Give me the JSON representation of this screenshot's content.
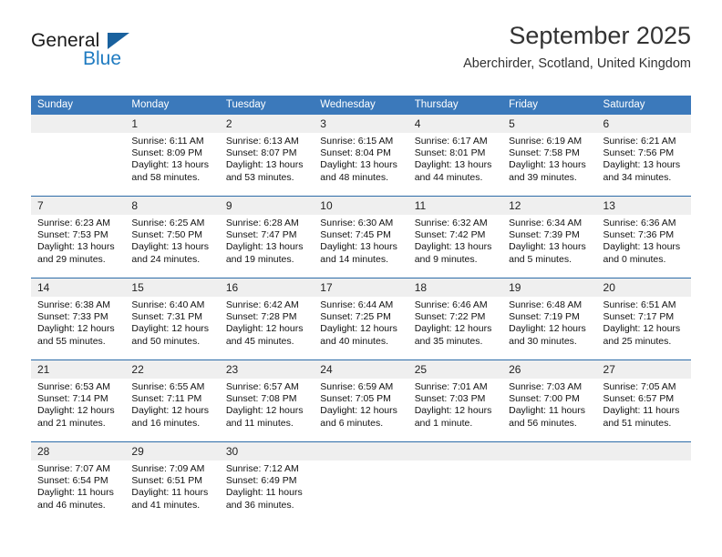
{
  "brand": {
    "name_top": "General",
    "name_bottom": "Blue",
    "accent_color": "#1f7bc1",
    "triangle_color": "#19619e"
  },
  "header": {
    "title": "September 2025",
    "subtitle": "Aberchirder, Scotland, United Kingdom"
  },
  "calendar": {
    "header_bg": "#3b79bb",
    "daynum_bg": "#efefef",
    "row_divider": "#2d6ca8",
    "weekdays": [
      "Sunday",
      "Monday",
      "Tuesday",
      "Wednesday",
      "Thursday",
      "Friday",
      "Saturday"
    ],
    "weeks": [
      [
        {
          "day": "",
          "sunrise": "",
          "sunset": "",
          "daylight": ""
        },
        {
          "day": "1",
          "sunrise": "Sunrise: 6:11 AM",
          "sunset": "Sunset: 8:09 PM",
          "daylight": "Daylight: 13 hours and 58 minutes."
        },
        {
          "day": "2",
          "sunrise": "Sunrise: 6:13 AM",
          "sunset": "Sunset: 8:07 PM",
          "daylight": "Daylight: 13 hours and 53 minutes."
        },
        {
          "day": "3",
          "sunrise": "Sunrise: 6:15 AM",
          "sunset": "Sunset: 8:04 PM",
          "daylight": "Daylight: 13 hours and 48 minutes."
        },
        {
          "day": "4",
          "sunrise": "Sunrise: 6:17 AM",
          "sunset": "Sunset: 8:01 PM",
          "daylight": "Daylight: 13 hours and 44 minutes."
        },
        {
          "day": "5",
          "sunrise": "Sunrise: 6:19 AM",
          "sunset": "Sunset: 7:58 PM",
          "daylight": "Daylight: 13 hours and 39 minutes."
        },
        {
          "day": "6",
          "sunrise": "Sunrise: 6:21 AM",
          "sunset": "Sunset: 7:56 PM",
          "daylight": "Daylight: 13 hours and 34 minutes."
        }
      ],
      [
        {
          "day": "7",
          "sunrise": "Sunrise: 6:23 AM",
          "sunset": "Sunset: 7:53 PM",
          "daylight": "Daylight: 13 hours and 29 minutes."
        },
        {
          "day": "8",
          "sunrise": "Sunrise: 6:25 AM",
          "sunset": "Sunset: 7:50 PM",
          "daylight": "Daylight: 13 hours and 24 minutes."
        },
        {
          "day": "9",
          "sunrise": "Sunrise: 6:28 AM",
          "sunset": "Sunset: 7:47 PM",
          "daylight": "Daylight: 13 hours and 19 minutes."
        },
        {
          "day": "10",
          "sunrise": "Sunrise: 6:30 AM",
          "sunset": "Sunset: 7:45 PM",
          "daylight": "Daylight: 13 hours and 14 minutes."
        },
        {
          "day": "11",
          "sunrise": "Sunrise: 6:32 AM",
          "sunset": "Sunset: 7:42 PM",
          "daylight": "Daylight: 13 hours and 9 minutes."
        },
        {
          "day": "12",
          "sunrise": "Sunrise: 6:34 AM",
          "sunset": "Sunset: 7:39 PM",
          "daylight": "Daylight: 13 hours and 5 minutes."
        },
        {
          "day": "13",
          "sunrise": "Sunrise: 6:36 AM",
          "sunset": "Sunset: 7:36 PM",
          "daylight": "Daylight: 13 hours and 0 minutes."
        }
      ],
      [
        {
          "day": "14",
          "sunrise": "Sunrise: 6:38 AM",
          "sunset": "Sunset: 7:33 PM",
          "daylight": "Daylight: 12 hours and 55 minutes."
        },
        {
          "day": "15",
          "sunrise": "Sunrise: 6:40 AM",
          "sunset": "Sunset: 7:31 PM",
          "daylight": "Daylight: 12 hours and 50 minutes."
        },
        {
          "day": "16",
          "sunrise": "Sunrise: 6:42 AM",
          "sunset": "Sunset: 7:28 PM",
          "daylight": "Daylight: 12 hours and 45 minutes."
        },
        {
          "day": "17",
          "sunrise": "Sunrise: 6:44 AM",
          "sunset": "Sunset: 7:25 PM",
          "daylight": "Daylight: 12 hours and 40 minutes."
        },
        {
          "day": "18",
          "sunrise": "Sunrise: 6:46 AM",
          "sunset": "Sunset: 7:22 PM",
          "daylight": "Daylight: 12 hours and 35 minutes."
        },
        {
          "day": "19",
          "sunrise": "Sunrise: 6:48 AM",
          "sunset": "Sunset: 7:19 PM",
          "daylight": "Daylight: 12 hours and 30 minutes."
        },
        {
          "day": "20",
          "sunrise": "Sunrise: 6:51 AM",
          "sunset": "Sunset: 7:17 PM",
          "daylight": "Daylight: 12 hours and 25 minutes."
        }
      ],
      [
        {
          "day": "21",
          "sunrise": "Sunrise: 6:53 AM",
          "sunset": "Sunset: 7:14 PM",
          "daylight": "Daylight: 12 hours and 21 minutes."
        },
        {
          "day": "22",
          "sunrise": "Sunrise: 6:55 AM",
          "sunset": "Sunset: 7:11 PM",
          "daylight": "Daylight: 12 hours and 16 minutes."
        },
        {
          "day": "23",
          "sunrise": "Sunrise: 6:57 AM",
          "sunset": "Sunset: 7:08 PM",
          "daylight": "Daylight: 12 hours and 11 minutes."
        },
        {
          "day": "24",
          "sunrise": "Sunrise: 6:59 AM",
          "sunset": "Sunset: 7:05 PM",
          "daylight": "Daylight: 12 hours and 6 minutes."
        },
        {
          "day": "25",
          "sunrise": "Sunrise: 7:01 AM",
          "sunset": "Sunset: 7:03 PM",
          "daylight": "Daylight: 12 hours and 1 minute."
        },
        {
          "day": "26",
          "sunrise": "Sunrise: 7:03 AM",
          "sunset": "Sunset: 7:00 PM",
          "daylight": "Daylight: 11 hours and 56 minutes."
        },
        {
          "day": "27",
          "sunrise": "Sunrise: 7:05 AM",
          "sunset": "Sunset: 6:57 PM",
          "daylight": "Daylight: 11 hours and 51 minutes."
        }
      ],
      [
        {
          "day": "28",
          "sunrise": "Sunrise: 7:07 AM",
          "sunset": "Sunset: 6:54 PM",
          "daylight": "Daylight: 11 hours and 46 minutes."
        },
        {
          "day": "29",
          "sunrise": "Sunrise: 7:09 AM",
          "sunset": "Sunset: 6:51 PM",
          "daylight": "Daylight: 11 hours and 41 minutes."
        },
        {
          "day": "30",
          "sunrise": "Sunrise: 7:12 AM",
          "sunset": "Sunset: 6:49 PM",
          "daylight": "Daylight: 11 hours and 36 minutes."
        },
        {
          "day": "",
          "sunrise": "",
          "sunset": "",
          "daylight": ""
        },
        {
          "day": "",
          "sunrise": "",
          "sunset": "",
          "daylight": ""
        },
        {
          "day": "",
          "sunrise": "",
          "sunset": "",
          "daylight": ""
        },
        {
          "day": "",
          "sunrise": "",
          "sunset": "",
          "daylight": ""
        }
      ]
    ]
  }
}
